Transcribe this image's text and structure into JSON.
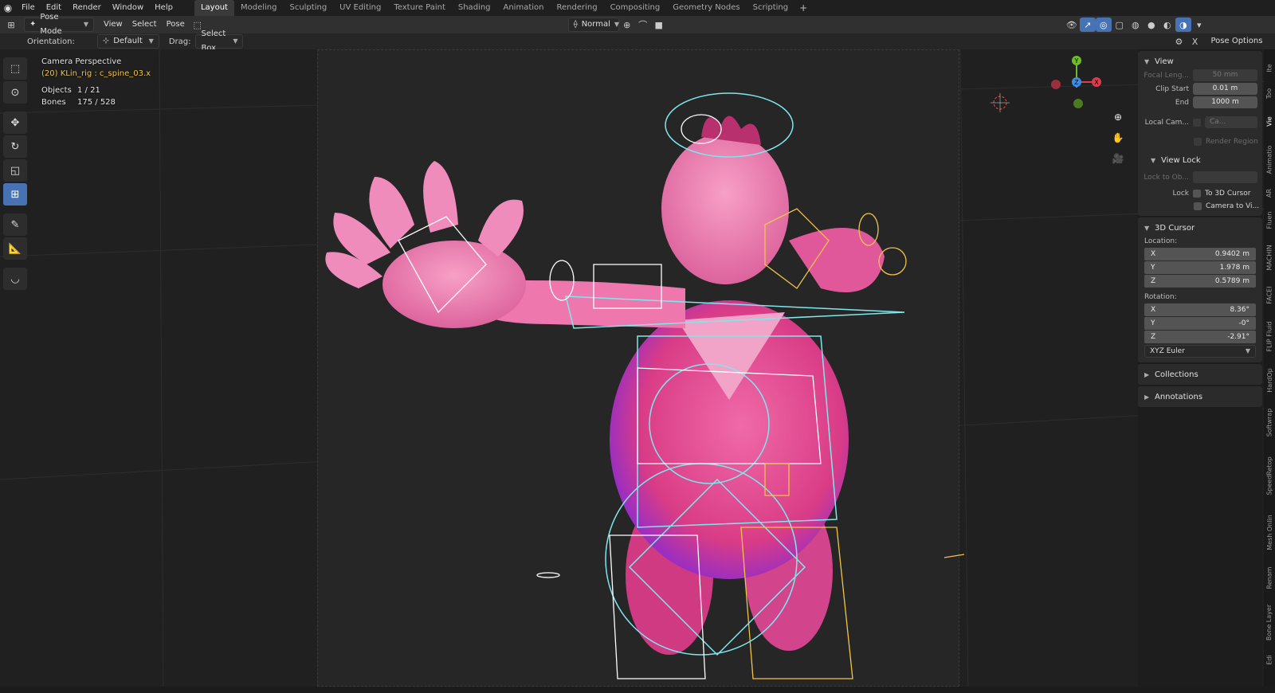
{
  "top_menu": [
    "File",
    "Edit",
    "Render",
    "Window",
    "Help"
  ],
  "workspaces": [
    "Layout",
    "Modeling",
    "Sculpting",
    "UV Editing",
    "Texture Paint",
    "Shading",
    "Animation",
    "Rendering",
    "Compositing",
    "Geometry Nodes",
    "Scripting"
  ],
  "active_workspace": "Layout",
  "header": {
    "mode": "Pose Mode",
    "menus": [
      "View",
      "Select",
      "Pose"
    ],
    "transform_orientation": "Normal",
    "pose_options": "Pose Options"
  },
  "tool_header": {
    "orientation_label": "Orientation:",
    "orientation_value": "Default",
    "drag_label": "Drag:",
    "drag_value": "Select Box"
  },
  "viewport_info": {
    "view_name": "Camera Perspective",
    "selection": "(20) KLin_rig : c_spine_03.x",
    "objects_label": "Objects",
    "objects_value": "1 / 21",
    "bones_label": "Bones",
    "bones_value": "175 / 528"
  },
  "gizmo_axes": [
    "X",
    "Y",
    "Z"
  ],
  "npanel": {
    "view": {
      "title": "View",
      "focal_label": "Focal Leng...",
      "focal_value": "50 mm",
      "clip_start_label": "Clip Start",
      "clip_start_value": "0.01 m",
      "end_label": "End",
      "end_value": "1000 m",
      "local_cam_label": "Local Cam...",
      "local_cam_value": "Ca...",
      "render_region": "Render Region"
    },
    "view_lock": {
      "title": "View Lock",
      "lock_to_label": "Lock to Ob...",
      "lock_label": "Lock",
      "to_3d_cursor": "To 3D Cursor",
      "camera_to_view": "Camera to Vi..."
    },
    "cursor": {
      "title": "3D Cursor",
      "location_label": "Location:",
      "loc_x": "0.9402 m",
      "loc_y": "1.978 m",
      "loc_z": "0.5789 m",
      "rotation_label": "Rotation:",
      "rot_x": "8.36°",
      "rot_y": "-0°",
      "rot_z": "-2.91°",
      "mode": "XYZ Euler"
    },
    "collections": "Collections",
    "annotations": "Annotations"
  },
  "side_tabs": [
    "Ite",
    "Too",
    "Vie",
    "Animatio",
    "AR",
    "Fluen",
    "MACHIN",
    "FACEI",
    "FLIP Fluid",
    "HardOp",
    "Softwrap",
    "SpeedRetop",
    "Mesh Onlin",
    "Renam",
    "Bone Layer",
    "Edi"
  ],
  "colors": {
    "accent": "#4772b3",
    "selection_text": "#f2c44a",
    "character_pink": "#e0488f",
    "rig_cyan": "#7fe7ec",
    "rig_yellow": "#f2c44a"
  }
}
